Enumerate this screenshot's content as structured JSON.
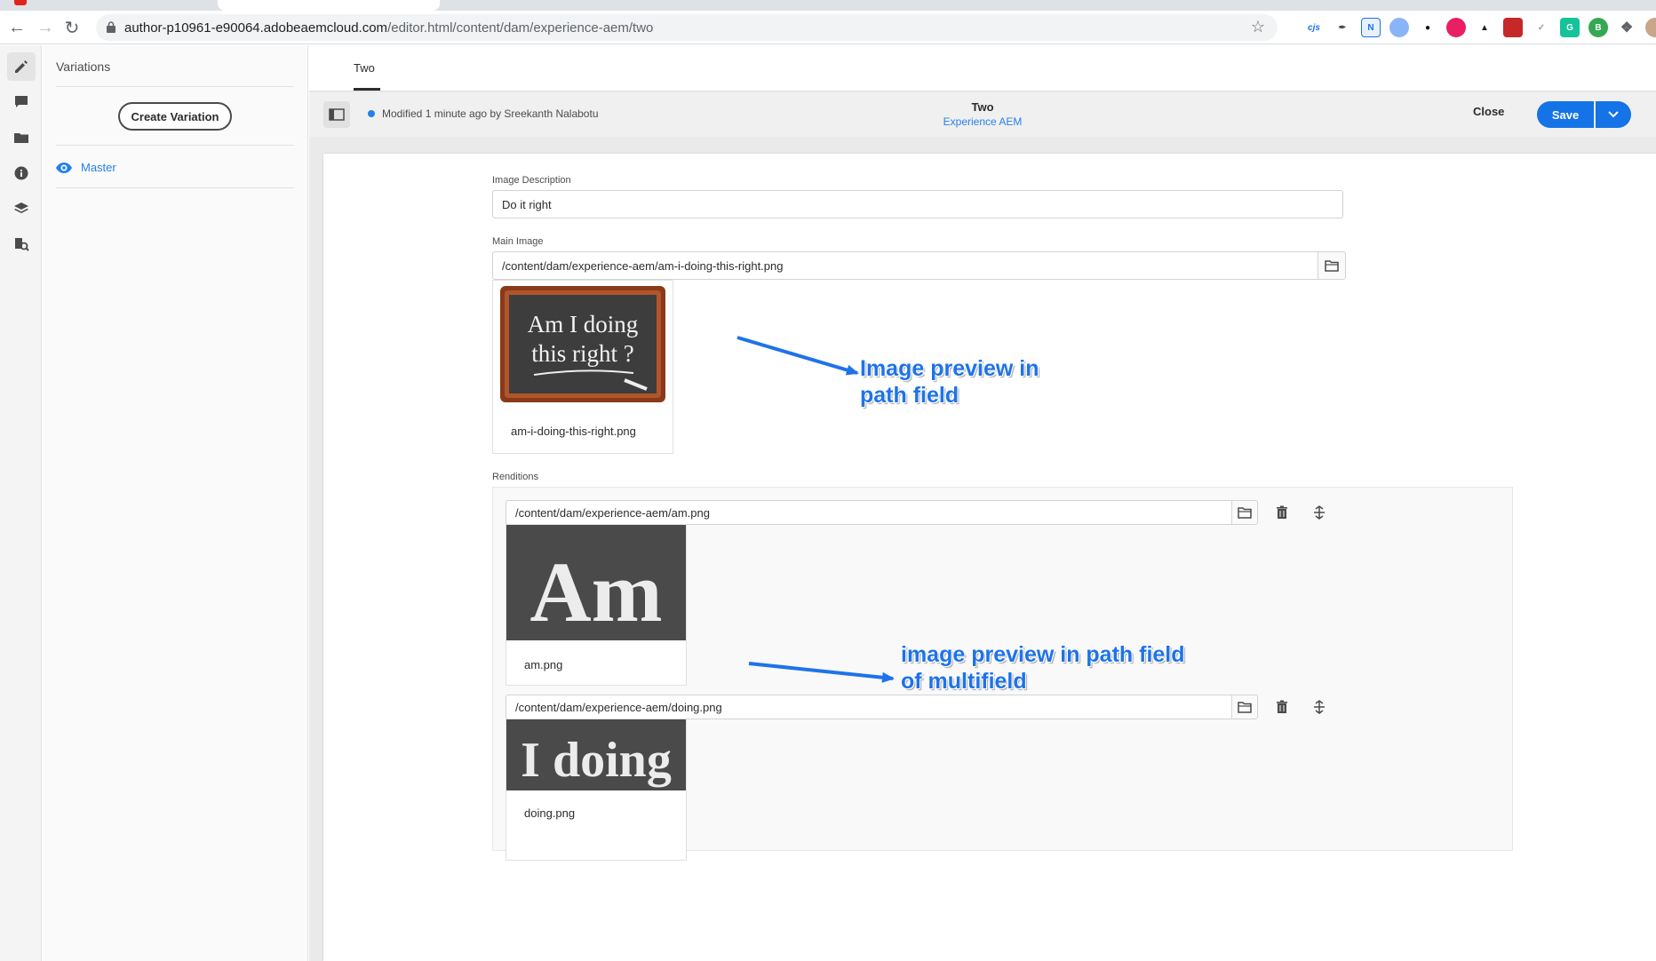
{
  "browser": {
    "url_host": "author-p10961-e90064.adobeaemcloud.com",
    "url_path": "/editor.html/content/dam/experience-aem/two"
  },
  "rail": {
    "items": [
      "pencil-icon",
      "comment-icon",
      "folder-icon",
      "info-icon",
      "layers-icon",
      "references-icon"
    ]
  },
  "variations": {
    "title": "Variations",
    "create_label": "Create Variation",
    "master_label": "Master"
  },
  "editor": {
    "tab_label": "Two",
    "status": "Modified 1 minute ago by Sreekanth Nalabotu",
    "title": "Two",
    "subtitle": "Experience AEM",
    "close_label": "Close",
    "save_label": "Save"
  },
  "form": {
    "image_description": {
      "label": "Image Description",
      "value": "Do it right"
    },
    "main_image": {
      "label": "Main Image",
      "value": "/content/dam/experience-aem/am-i-doing-this-right.png",
      "preview_name": "am-i-doing-this-right.png",
      "preview_text_line1": "Am I doing",
      "preview_text_line2": "this right ?"
    },
    "renditions": {
      "label": "Renditions",
      "items": [
        {
          "value": "/content/dam/experience-aem/am.png",
          "preview_name": "am.png",
          "preview_text": "Am"
        },
        {
          "value": "/content/dam/experience-aem/doing.png",
          "preview_name": "doing.png",
          "preview_text": "I doing"
        }
      ]
    }
  },
  "annotations": {
    "first_line1": "Image preview in",
    "first_line2": "path field",
    "second_line1": "image preview in path field",
    "second_line2": "of multifield"
  },
  "colors": {
    "accent": "#1473e6",
    "link": "#2680eb",
    "annotation": "#1e73e8"
  }
}
